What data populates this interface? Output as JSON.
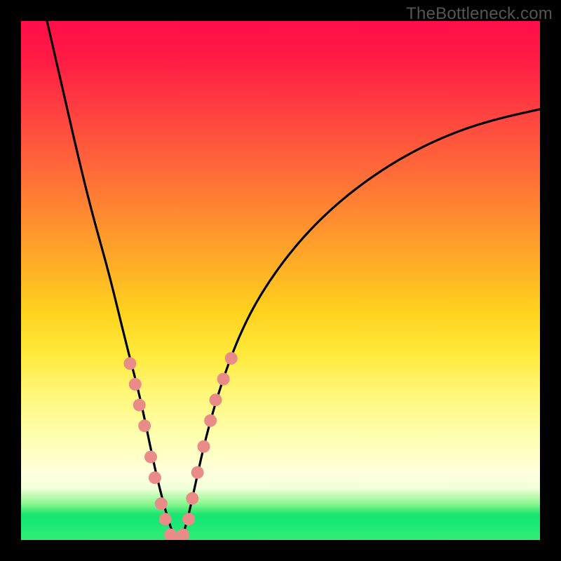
{
  "watermark": {
    "text": "TheBottleneck.com"
  },
  "chart_data": {
    "type": "line",
    "title": "",
    "xlabel": "",
    "ylabel": "",
    "xlim": [
      0,
      100
    ],
    "ylim": [
      0,
      100
    ],
    "grid": false,
    "legend": false,
    "background_gradient": {
      "stops": [
        {
          "pos": 0,
          "color": "#ff0f47"
        },
        {
          "pos": 20,
          "color": "#ff4a3f"
        },
        {
          "pos": 47,
          "color": "#ffae26"
        },
        {
          "pos": 72,
          "color": "#fff77a"
        },
        {
          "pos": 90,
          "color": "#f2ffda"
        },
        {
          "pos": 95,
          "color": "#1ee56f"
        },
        {
          "pos": 100,
          "color": "#34ed76"
        }
      ]
    },
    "series": [
      {
        "name": "bottleneck-curve",
        "color": "#000000",
        "x": [
          5,
          8,
          11,
          14,
          17,
          19,
          21,
          23,
          24.5,
          26,
          27.5,
          29,
          30,
          31.5,
          33,
          35,
          38,
          42,
          48,
          56,
          65,
          76,
          88,
          100
        ],
        "y": [
          100,
          87,
          74,
          62,
          51,
          43,
          35,
          27,
          20,
          13,
          7,
          2,
          0,
          2,
          8,
          17,
          28,
          39,
          50,
          60,
          68,
          75,
          80,
          83
        ]
      }
    ],
    "markers": {
      "name": "highlight-dots",
      "color": "#e98c88",
      "radius": 9,
      "points": [
        {
          "x": 21.0,
          "y": 34
        },
        {
          "x": 22.0,
          "y": 30
        },
        {
          "x": 22.8,
          "y": 26
        },
        {
          "x": 23.8,
          "y": 22
        },
        {
          "x": 25.0,
          "y": 16
        },
        {
          "x": 25.8,
          "y": 12
        },
        {
          "x": 27.0,
          "y": 7
        },
        {
          "x": 27.8,
          "y": 4
        },
        {
          "x": 28.8,
          "y": 1
        },
        {
          "x": 30.0,
          "y": 0
        },
        {
          "x": 31.2,
          "y": 1
        },
        {
          "x": 32.3,
          "y": 4
        },
        {
          "x": 33.0,
          "y": 8
        },
        {
          "x": 34.0,
          "y": 13
        },
        {
          "x": 35.2,
          "y": 18
        },
        {
          "x": 36.5,
          "y": 23
        },
        {
          "x": 37.5,
          "y": 27
        },
        {
          "x": 39.0,
          "y": 31
        },
        {
          "x": 40.5,
          "y": 35
        }
      ]
    }
  }
}
